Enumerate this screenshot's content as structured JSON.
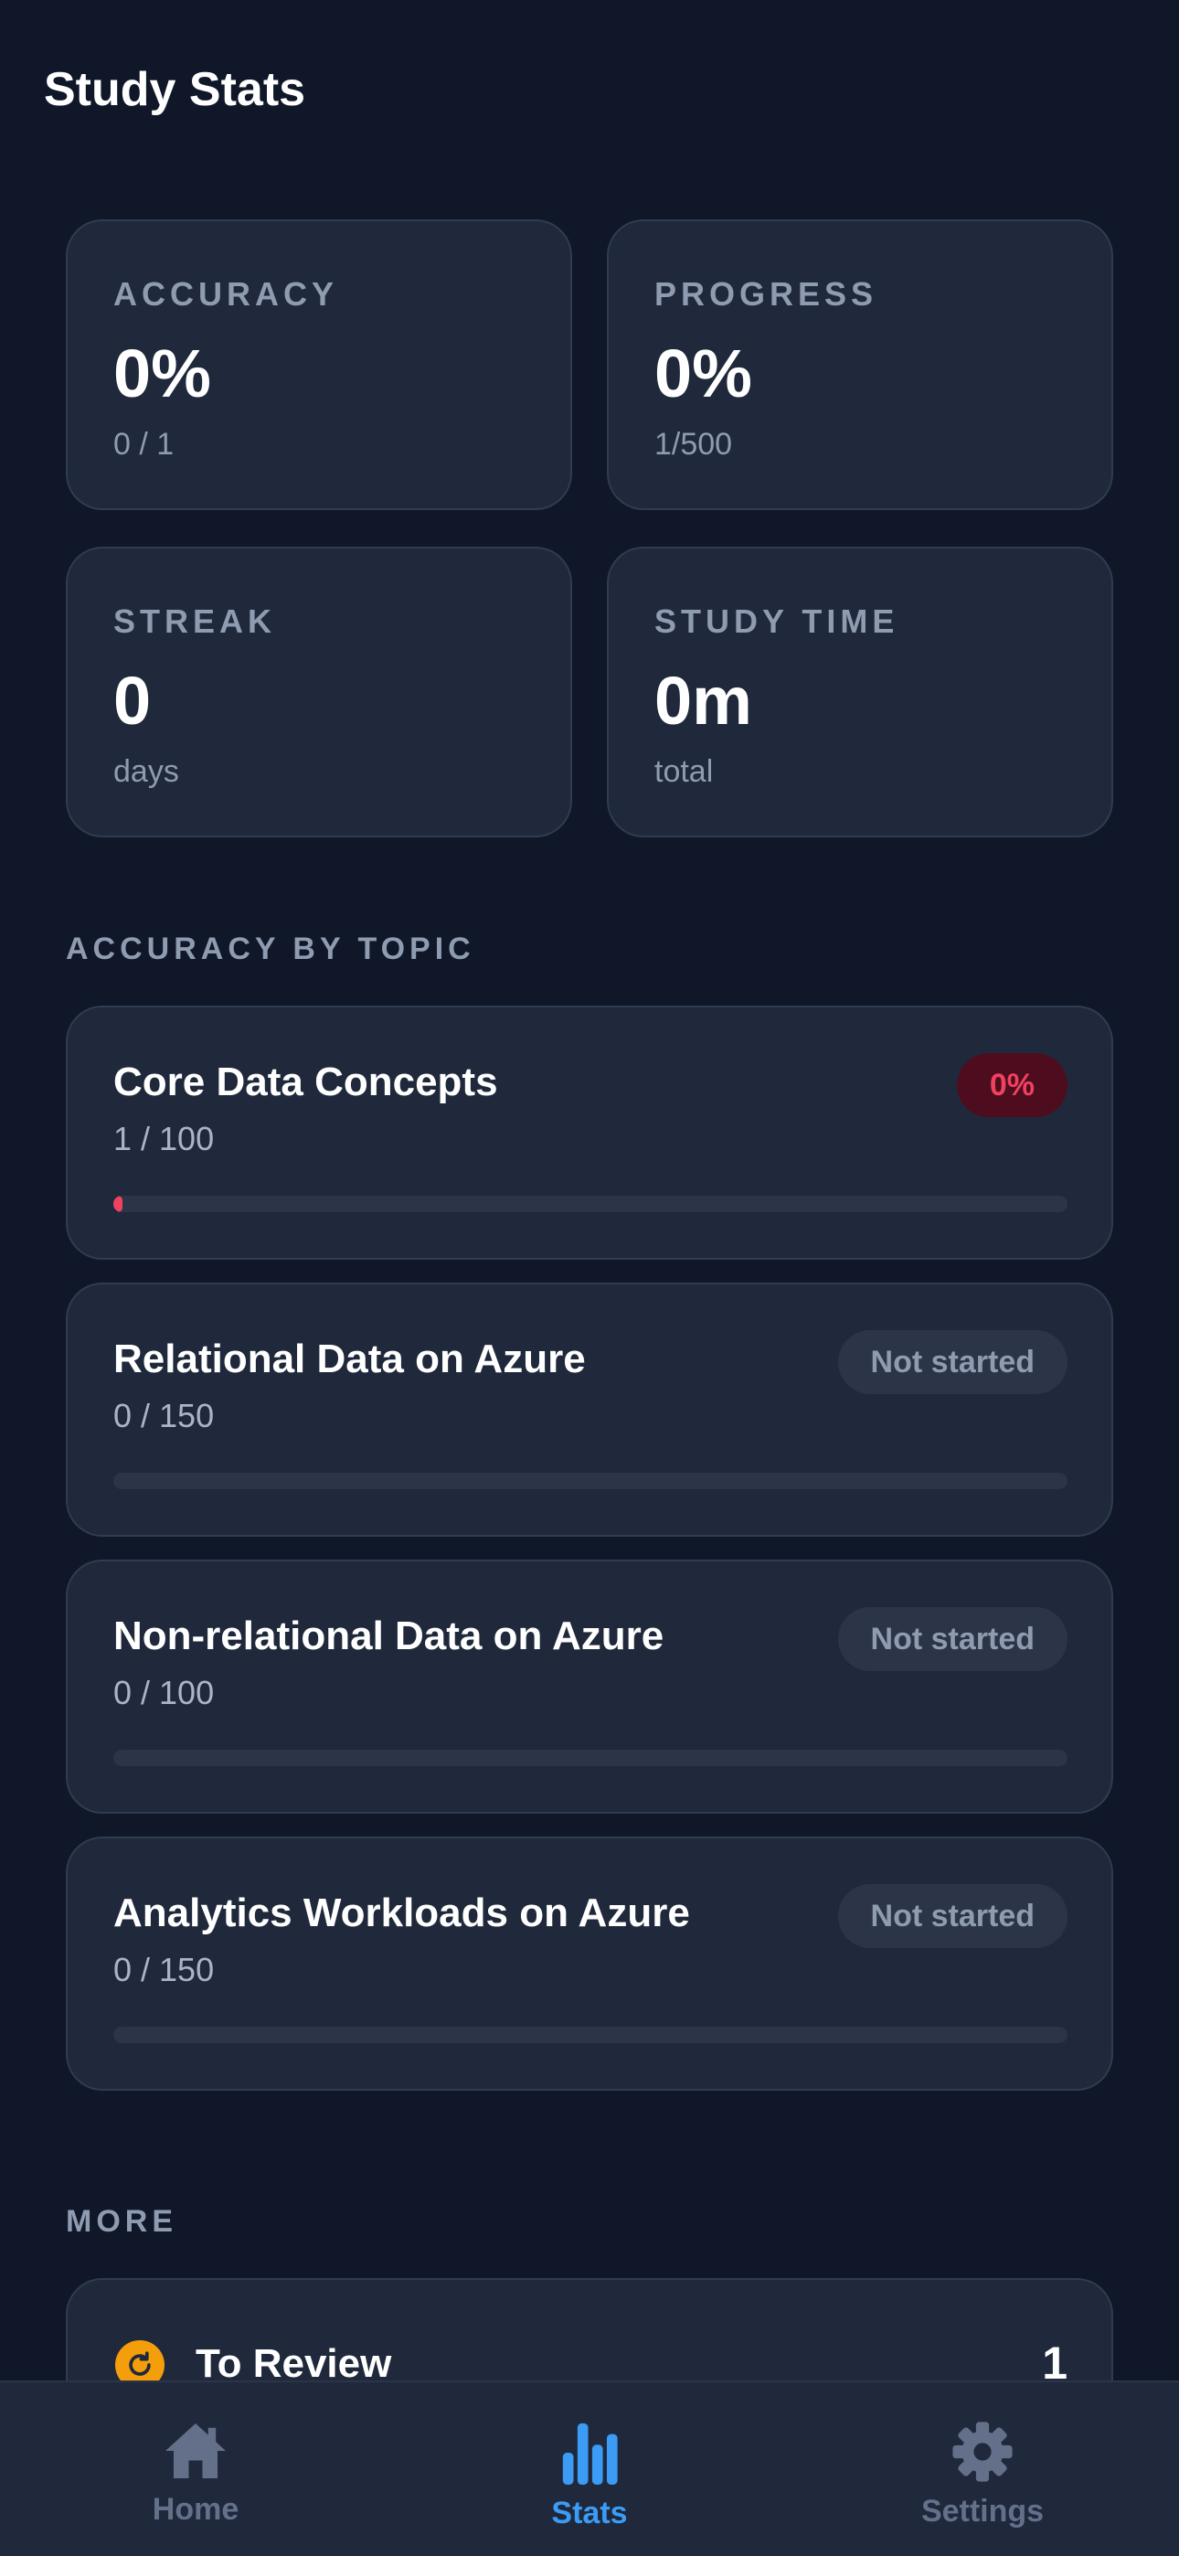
{
  "header": {
    "title": "Study Stats"
  },
  "stats": [
    {
      "label": "ACCURACY",
      "value": "0%",
      "sub": "0 / 1"
    },
    {
      "label": "PROGRESS",
      "value": "0%",
      "sub": "1/500"
    },
    {
      "label": "STREAK",
      "value": "0",
      "sub": "days"
    },
    {
      "label": "STUDY TIME",
      "value": "0m",
      "sub": "total"
    }
  ],
  "topics_section": {
    "label": "ACCURACY BY TOPIC"
  },
  "topics": [
    {
      "name": "Core Data Concepts",
      "count": "1 / 100",
      "badge": "0%",
      "progress_percent": 1
    },
    {
      "name": "Relational Data on Azure",
      "count": "0 / 150",
      "badge": "Not started",
      "progress_percent": 0
    },
    {
      "name": "Non-relational Data on Azure",
      "count": "0 / 100",
      "badge": "Not started",
      "progress_percent": 0
    },
    {
      "name": "Analytics Workloads on Azure",
      "count": "0 / 150",
      "badge": "Not started",
      "progress_percent": 0
    }
  ],
  "more_section": {
    "label": "MORE",
    "review_label": "To Review",
    "review_count": "1",
    "review_icon": "refresh-icon"
  },
  "tabs": [
    {
      "label": "Home",
      "icon": "home-icon",
      "active": false
    },
    {
      "label": "Stats",
      "icon": "bar-chart-icon",
      "active": true
    },
    {
      "label": "Settings",
      "icon": "gear-icon",
      "active": false
    }
  ],
  "colors": {
    "background": "#0f1729",
    "card": "#1f293b",
    "accent": "#3b9bf5",
    "danger": "#f0415f",
    "warning": "#f59e0b"
  }
}
